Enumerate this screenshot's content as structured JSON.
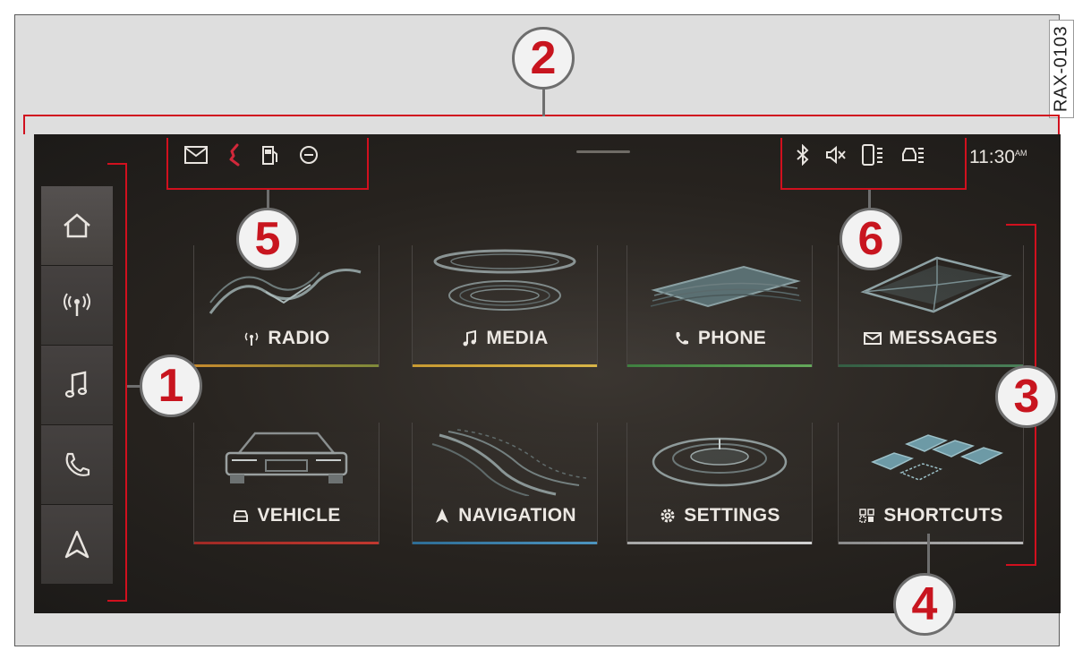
{
  "figure_code": "RAX-0103",
  "status_bar": {
    "clock": "11:30",
    "clock_suffix": "AM",
    "left_icons": [
      "mail-icon",
      "phone-missed-icon",
      "fuel-icon",
      "do-not-disturb-icon"
    ],
    "right_icons": [
      "bluetooth-icon",
      "mute-icon",
      "phone-signal-icon",
      "car-signal-icon"
    ]
  },
  "sidebar": {
    "items": [
      {
        "icon": "home-icon"
      },
      {
        "icon": "radio-icon"
      },
      {
        "icon": "music-icon"
      },
      {
        "icon": "phone-icon"
      },
      {
        "icon": "navigation-icon"
      }
    ]
  },
  "tiles": [
    {
      "label": "RADIO",
      "icon": "radio-icon",
      "color": "#c58a2e"
    },
    {
      "label": "MEDIA",
      "icon": "music-icon",
      "color": "#d0a83a"
    },
    {
      "label": "PHONE",
      "icon": "phone-icon",
      "color": "#5a9a4a"
    },
    {
      "label": "MESSAGES",
      "icon": "mail-icon",
      "color": "#3f7f58"
    },
    {
      "label": "VEHICLE",
      "icon": "car-icon",
      "color": "#b3322c"
    },
    {
      "label": "NAVIGATION",
      "icon": "navigation-icon",
      "color": "#3c7fa8"
    },
    {
      "label": "SETTINGS",
      "icon": "gear-icon",
      "color": "#c6c6c6"
    },
    {
      "label": "SHORTCUTS",
      "icon": "grid-icon",
      "color": "#a2a2a2"
    }
  ],
  "callouts": [
    "1",
    "2",
    "3",
    "4",
    "5",
    "6"
  ],
  "colors": {
    "callout_red": "#d1101e",
    "number_red": "#c8151f"
  }
}
